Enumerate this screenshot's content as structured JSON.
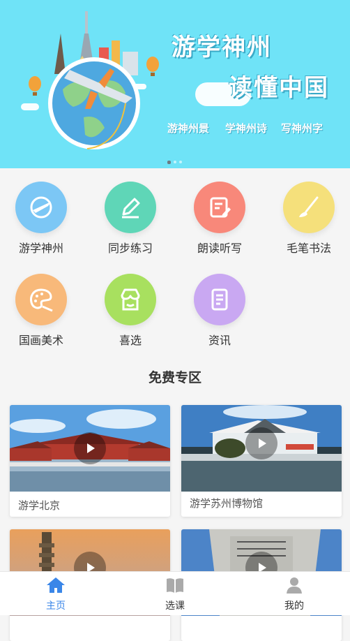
{
  "banner": {
    "title_line1": "游学神州",
    "title_line2": "读懂中国",
    "subtitles": [
      "游神州景",
      "学神州诗",
      "写神州字"
    ]
  },
  "menu": [
    {
      "label": "游学神州",
      "icon": "plane-globe-icon",
      "color": "#7cc7f5"
    },
    {
      "label": "同步练习",
      "icon": "pencil-icon",
      "color": "#5fd6b7"
    },
    {
      "label": "朗读听写",
      "icon": "note-edit-icon",
      "color": "#f8887a"
    },
    {
      "label": "毛笔书法",
      "icon": "brush-icon",
      "color": "#f5e07b"
    },
    {
      "label": "国画美术",
      "icon": "palette-icon",
      "color": "#f8b97a"
    },
    {
      "label": "喜选",
      "icon": "shop-icon",
      "color": "#a8e05f"
    },
    {
      "label": "资讯",
      "icon": "document-icon",
      "color": "#c9a8f2"
    }
  ],
  "free_section": {
    "title": "免费专区",
    "cards": [
      {
        "title": "游学北京"
      },
      {
        "title": "游学苏州博物馆"
      },
      {
        "title": ""
      },
      {
        "title": ""
      }
    ]
  },
  "tabbar": {
    "active_color": "#3a86e8",
    "items": [
      {
        "label": "主页",
        "icon": "home-icon",
        "active": true
      },
      {
        "label": "选课",
        "icon": "book-icon",
        "active": false
      },
      {
        "label": "我的",
        "icon": "user-icon",
        "active": false
      }
    ]
  }
}
